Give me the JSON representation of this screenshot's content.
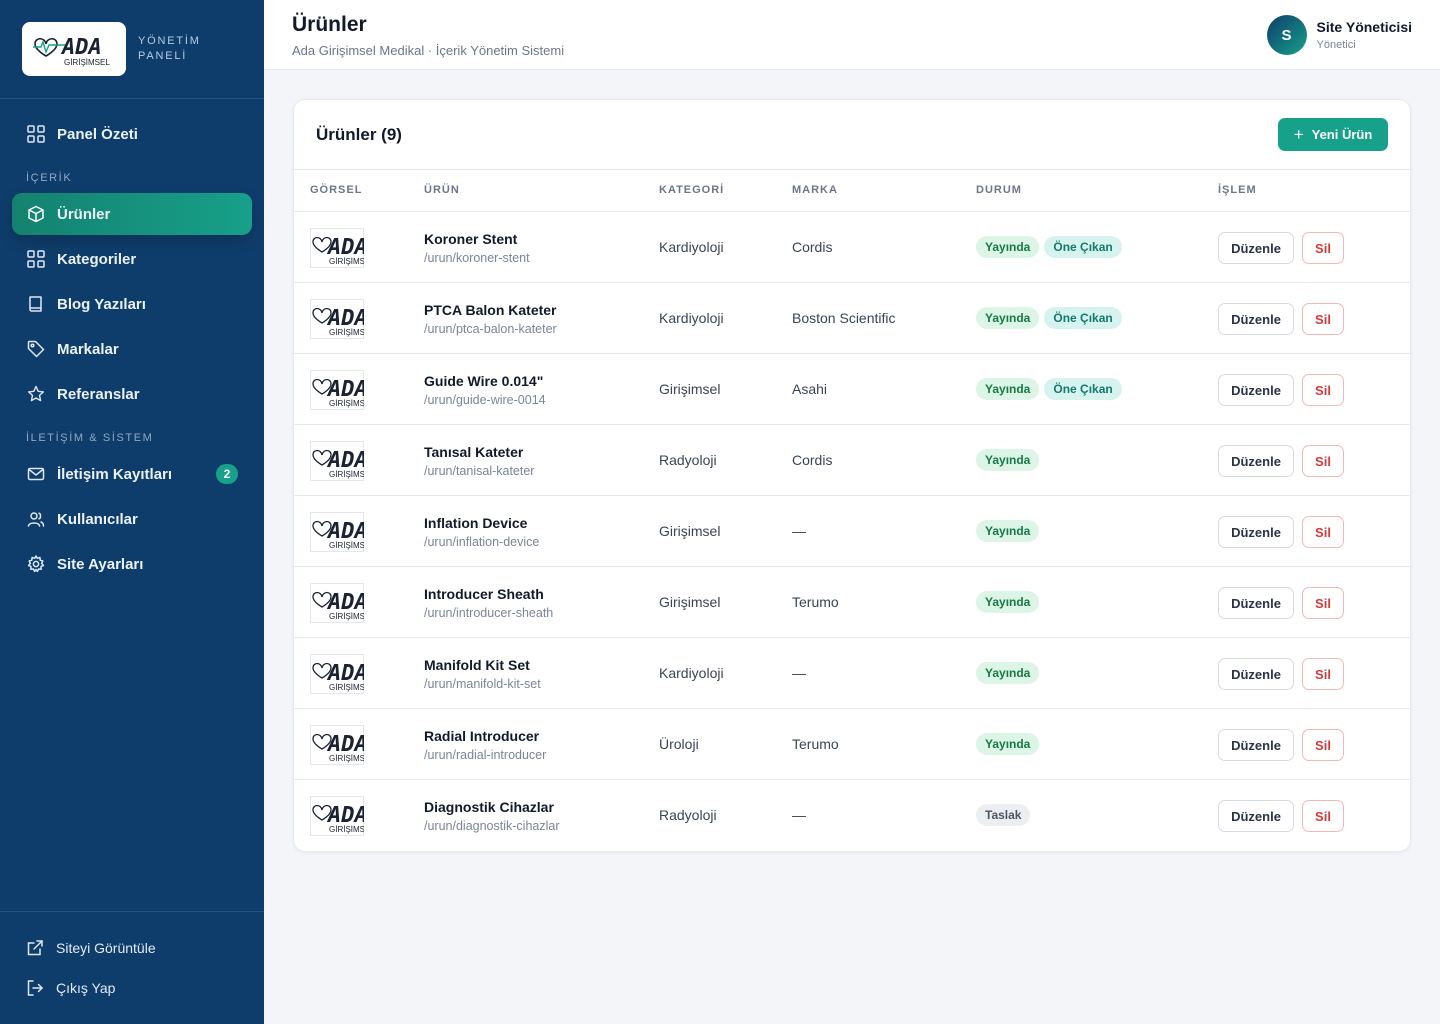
{
  "brand": {
    "logo_main": "ADA",
    "logo_sub": "GİRİŞİMSEL",
    "panel_line1": "YÖNETİM",
    "panel_line2": "PANELİ"
  },
  "sidebar": {
    "items": [
      {
        "label": "Panel Özeti",
        "icon": "grid-icon"
      },
      {
        "section": "İÇERİK"
      },
      {
        "label": "Ürünler",
        "icon": "box-icon",
        "active": true
      },
      {
        "label": "Kategoriler",
        "icon": "grid-icon"
      },
      {
        "label": "Blog Yazıları",
        "icon": "book-icon"
      },
      {
        "label": "Markalar",
        "icon": "tag-icon"
      },
      {
        "label": "Referanslar",
        "icon": "star-icon"
      },
      {
        "section": "İLETİŞİM & SİSTEM"
      },
      {
        "label": "İletişim Kayıtları",
        "icon": "mail-icon",
        "badge": "2"
      },
      {
        "label": "Kullanıcılar",
        "icon": "users-icon"
      },
      {
        "label": "Site Ayarları",
        "icon": "gear-icon"
      }
    ],
    "bottom": [
      {
        "label": "Siteyi Görüntüle",
        "icon": "external-link-icon"
      },
      {
        "label": "Çıkış Yap",
        "icon": "logout-icon"
      }
    ]
  },
  "header": {
    "title": "Ürünler",
    "subtitle": "Ada Girişimsel Medikal · İçerik Yönetim Sistemi",
    "user": {
      "initial": "S",
      "name": "Site Yöneticisi",
      "role": "Yönetici"
    }
  },
  "card": {
    "title": "Ürünler (9)",
    "new_button": "Yeni Ürün",
    "columns": [
      "GÖRSEL",
      "ÜRÜN",
      "KATEGORİ",
      "MARKA",
      "DURUM",
      "İŞLEM"
    ],
    "edit_label": "Düzenle",
    "delete_label": "Sil",
    "rows": [
      {
        "name": "Koroner Stent",
        "slug": "/urun/koroner-stent",
        "category": "Kardiyoloji",
        "brand": "Cordis",
        "badges": [
          "Yayında",
          "Öne Çıkan"
        ]
      },
      {
        "name": "PTCA Balon Kateter",
        "slug": "/urun/ptca-balon-kateter",
        "category": "Kardiyoloji",
        "brand": "Boston Scientific",
        "badges": [
          "Yayında",
          "Öne Çıkan"
        ]
      },
      {
        "name": "Guide Wire 0.014\"",
        "slug": "/urun/guide-wire-0014",
        "category": "Girişimsel",
        "brand": "Asahi",
        "badges": [
          "Yayında",
          "Öne Çıkan"
        ]
      },
      {
        "name": "Tanısal Kateter",
        "slug": "/urun/tanisal-kateter",
        "category": "Radyoloji",
        "brand": "Cordis",
        "badges": [
          "Yayında"
        ]
      },
      {
        "name": "Inflation Device",
        "slug": "/urun/inflation-device",
        "category": "Girişimsel",
        "brand": "—",
        "badges": [
          "Yayında"
        ]
      },
      {
        "name": "Introducer Sheath",
        "slug": "/urun/introducer-sheath",
        "category": "Girişimsel",
        "brand": "Terumo",
        "badges": [
          "Yayında"
        ]
      },
      {
        "name": "Manifold Kit Set",
        "slug": "/urun/manifold-kit-set",
        "category": "Kardiyoloji",
        "brand": "—",
        "badges": [
          "Yayında"
        ]
      },
      {
        "name": "Radial Introducer",
        "slug": "/urun/radial-introducer",
        "category": "Üroloji",
        "brand": "Terumo",
        "badges": [
          "Yayında"
        ]
      },
      {
        "name": "Diagnostik Cihazlar",
        "slug": "/urun/diagnostik-cihazlar",
        "category": "Radyoloji",
        "brand": "—",
        "badges": [
          "Taslak"
        ]
      }
    ]
  },
  "colors": {
    "sidebar": "#0f3d6b",
    "accent": "#17a08a",
    "danger": "#d33b3b"
  }
}
